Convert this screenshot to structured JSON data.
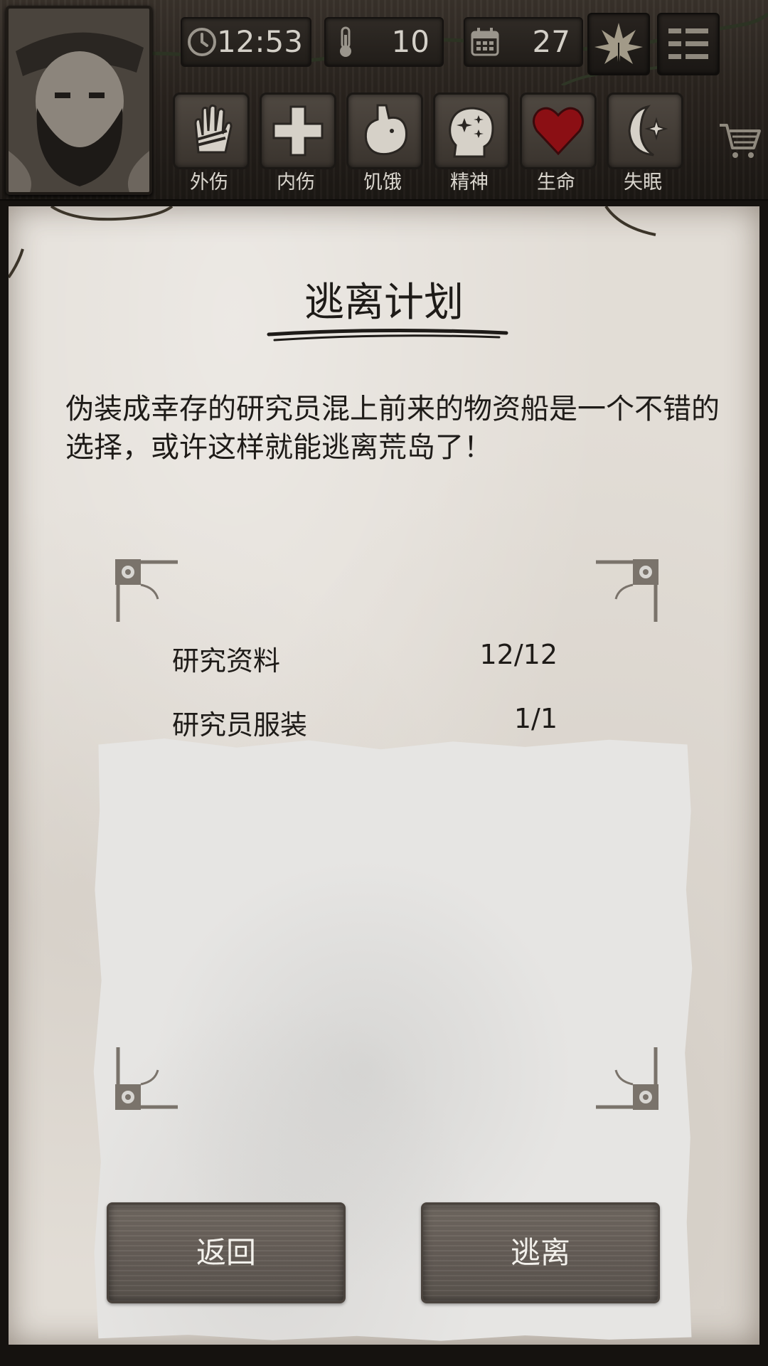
{
  "hud": {
    "time": "12:53",
    "temperature": "10",
    "day": "27",
    "statuses": [
      {
        "label": "外伤"
      },
      {
        "label": "内伤"
      },
      {
        "label": "饥饿"
      },
      {
        "label": "精神"
      },
      {
        "label": "生命"
      },
      {
        "label": "失眠"
      }
    ]
  },
  "plan": {
    "title": "逃离计划",
    "description": "伪装成幸存的研究员混上前来的物资船是一个不错的选择，或许这样就能逃离荒岛了！",
    "requirements": [
      {
        "name": "研究资料",
        "count": "12/12"
      },
      {
        "name": "研究员服装",
        "count": "1/1"
      }
    ]
  },
  "buttons": {
    "back_label": "返回",
    "escape_label": "逃离"
  }
}
